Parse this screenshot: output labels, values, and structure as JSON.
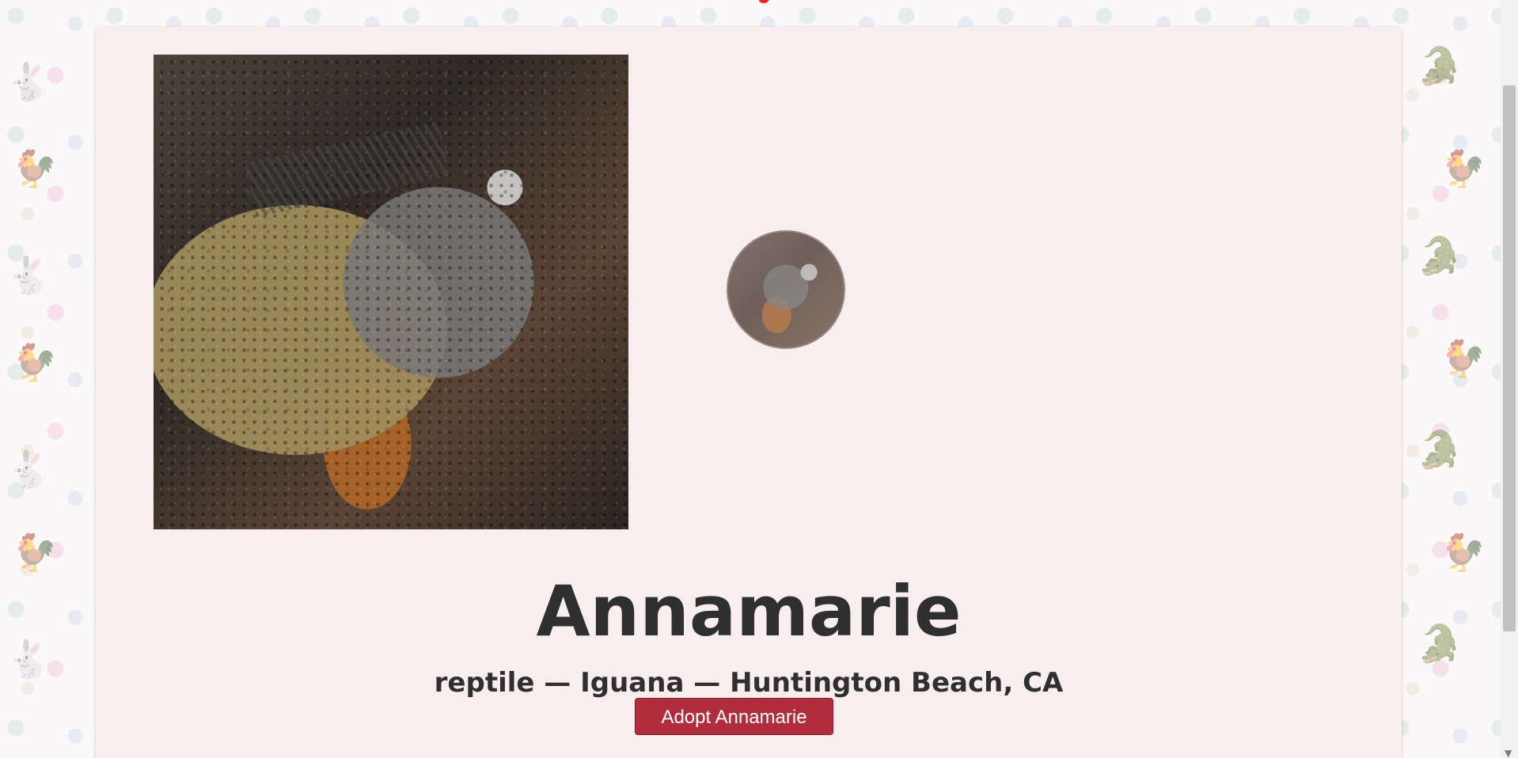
{
  "pet": {
    "name": "Annamarie",
    "details": "reptile — Iguana — Huntington Beach, CA",
    "adopt_label": "Adopt Annamarie"
  },
  "images": {
    "hero_subject": "iguana",
    "thumb_subject": "iguana"
  },
  "pattern": {
    "glyphs": [
      "🐇",
      "🐓",
      "🐊",
      "🐇",
      "🐓",
      "🐊"
    ]
  },
  "colors": {
    "card_bg": "#f8eef0",
    "button_bg": "#b12d3d",
    "heading": "#2f2f2f"
  }
}
